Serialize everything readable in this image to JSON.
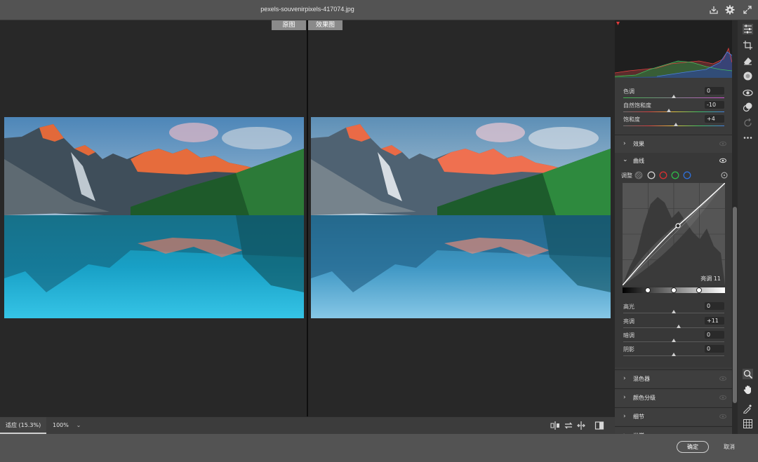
{
  "window": {
    "filename": "pexels-souvenirpixels-417074.jpg",
    "icons": [
      "download-icon",
      "settings-icon",
      "fullscreen-icon"
    ]
  },
  "canvas": {
    "before_label": "原图",
    "after_label": "效果图"
  },
  "statusbar": {
    "fit_label": "适应 (15.3%)",
    "zoom_label": "100%",
    "zoom_caret": "⌄",
    "view_icons": [
      "before-after-split-icon",
      "swap-icon",
      "copy-settings-icon",
      "toggle-compare-icon"
    ]
  },
  "panel": {
    "color": {
      "hue_label": "色调",
      "hue_value": "0",
      "hue_pos": 0.5,
      "vibrance_label": "自然饱和度",
      "vibrance_value": "-10",
      "vibrance_pos": 0.45,
      "saturation_label": "饱和度",
      "saturation_value": "+4",
      "saturation_pos": 0.52
    },
    "sections": {
      "effects": "效果",
      "curves": "曲线",
      "mixer": "混色器",
      "color_grading": "颜色分级",
      "detail": "细节",
      "optics": "光学"
    },
    "curves": {
      "adjust_label": "调整",
      "region_readout": "亮调 11",
      "channel_colors": [
        "#cfcfcf",
        "#d83030",
        "#2fb84a",
        "#2f6fd8"
      ],
      "highlights_label": "高光",
      "highlights_value": "0",
      "highlights_pos": 0.5,
      "lights_label": "亮调",
      "lights_value": "+11",
      "lights_pos": 0.55,
      "darks_label": "暗调",
      "darks_value": "0",
      "darks_pos": 0.5,
      "shadows_label": "阴影",
      "shadows_value": "0",
      "shadows_pos": 0.5
    }
  },
  "footer": {
    "ok_label": "确定",
    "cancel_label": "取消"
  },
  "tools": [
    "edit-sliders-icon",
    "crop-icon",
    "eraser-icon",
    "mask-circle-icon",
    "redeye-icon",
    "presets-icon",
    "snapshot-icon",
    "more-icon",
    "zoom-icon",
    "hand-icon",
    "color-sampler-icon",
    "grid-icon"
  ]
}
